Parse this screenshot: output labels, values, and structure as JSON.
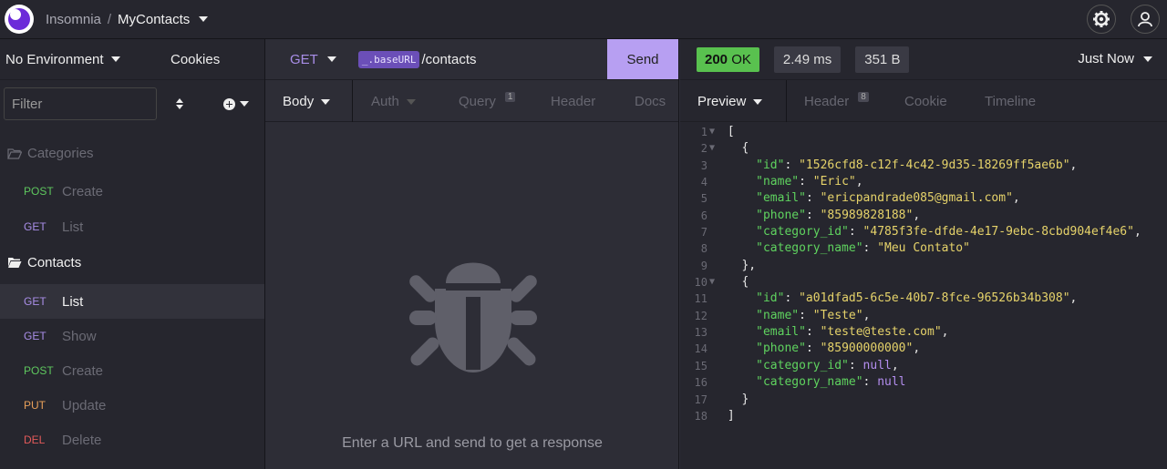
{
  "header": {
    "app_name": "Insomnia",
    "separator": "/",
    "project": "MyContacts"
  },
  "sidebar": {
    "environment": "No Environment",
    "cookies": "Cookies",
    "filter_placeholder": "Filter",
    "folders": [
      {
        "name": "Categories",
        "requests": [
          {
            "method": "POST",
            "name": "Create"
          },
          {
            "method": "GET",
            "name": "List"
          }
        ]
      },
      {
        "name": "Contacts",
        "requests": [
          {
            "method": "GET",
            "name": "List"
          },
          {
            "method": "GET",
            "name": "Show"
          },
          {
            "method": "POST",
            "name": "Create"
          },
          {
            "method": "PUT",
            "name": "Update"
          },
          {
            "method": "DEL",
            "name": "Delete"
          }
        ]
      }
    ]
  },
  "request": {
    "method": "GET",
    "url_variable": "_.baseURL",
    "url_path": "/contacts",
    "send_label": "Send",
    "tabs": {
      "body": "Body",
      "auth": "Auth",
      "query": "Query",
      "query_count": "1",
      "header": "Header",
      "docs": "Docs"
    },
    "empty_message": "Enter a URL and send to get a response"
  },
  "response": {
    "status_code": "200",
    "status_text": "OK",
    "time": "2.49 ms",
    "size": "351 B",
    "history": "Just Now",
    "tabs": {
      "preview": "Preview",
      "header": "Header",
      "header_count": "8",
      "cookie": "Cookie",
      "timeline": "Timeline"
    },
    "lines": [
      "[",
      "  {",
      "    \"id\": \"1526cfd8-c12f-4c42-9d35-18269ff5ae6b\",",
      "    \"name\": \"Eric\",",
      "    \"email\": \"ericpandrade085@gmail.com\",",
      "    \"phone\": \"85989828188\",",
      "    \"category_id\": \"4785f3fe-dfde-4e17-9ebc-8cbd904ef4e6\",",
      "    \"category_name\": \"Meu Contato\"",
      "  },",
      "  {",
      "    \"id\": \"a01dfad5-6c5e-40b7-8fce-96526b34b308\",",
      "    \"name\": \"Teste\",",
      "    \"email\": \"teste@teste.com\",",
      "    \"phone\": \"85900000000\",",
      "    \"category_id\": null,",
      "    \"category_name\": null",
      "  }",
      "]"
    ]
  },
  "colors": {
    "accent": "#b79ff2",
    "status_ok": "#59c14f",
    "get": "#a98ee8",
    "post": "#5ec75e",
    "put": "#e8a05a",
    "delete": "#e35a5a"
  }
}
